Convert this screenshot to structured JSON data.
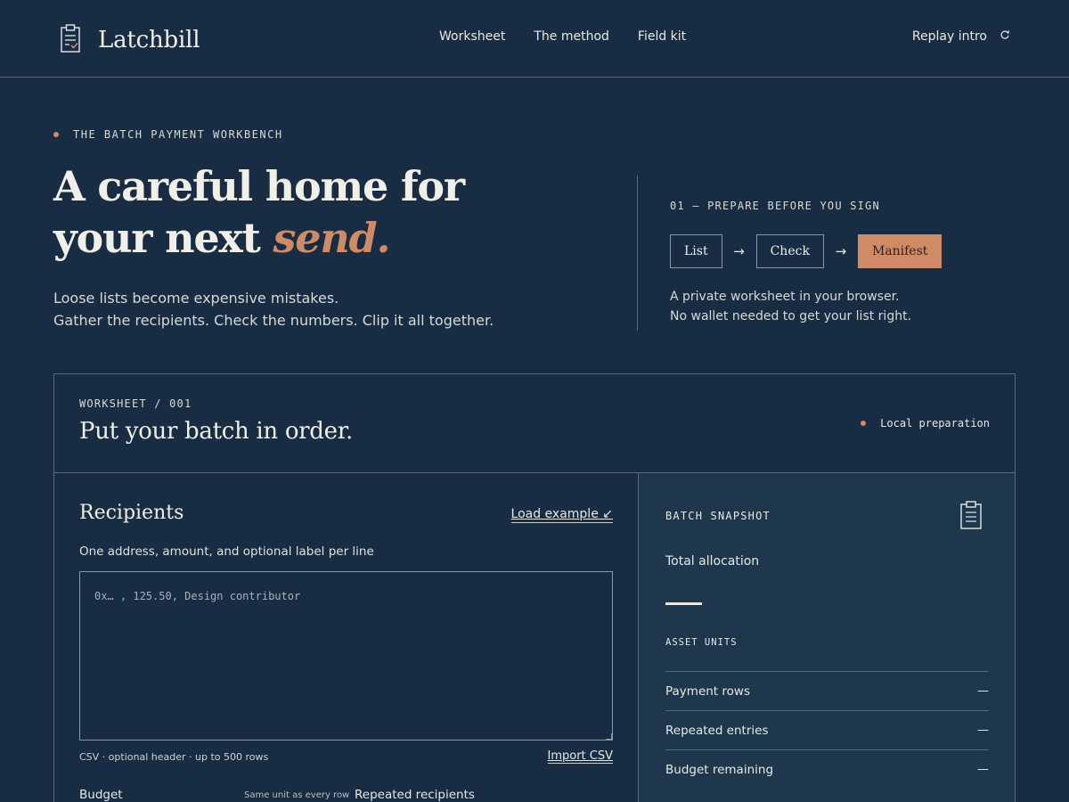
{
  "brand": {
    "name": "Latchbill"
  },
  "nav": {
    "items": [
      "Worksheet",
      "The method",
      "Field kit"
    ],
    "replay_label": "Replay intro"
  },
  "hero": {
    "eyebrow": "THE BATCH PAYMENT WORKBENCH",
    "title_line1": "A careful home for",
    "title_line2_start": "your next",
    "title_accent": "send.",
    "sub_line1": "Loose lists become expensive mistakes.",
    "sub_line2": "Gather the recipients. Check the numbers. Clip it all together."
  },
  "steps": {
    "label": "01 — PREPARE BEFORE YOU SIGN",
    "items": [
      "List",
      "Check",
      "Manifest"
    ],
    "active": "Manifest",
    "note_line1": "A private worksheet in your browser.",
    "note_line2": "No wallet needed to get your list right."
  },
  "worksheet": {
    "label": "WORKSHEET / 001",
    "title": "Put your batch in order.",
    "status": "Local preparation",
    "recipients": {
      "title": "Recipients",
      "load_example": "Load example ↙",
      "help": "One address, amount, and optional label per line",
      "value": "",
      "placeholder": "0x… , 125.50, Design contributor",
      "csv_note": "CSV · optional header · up to 500 rows",
      "import_label": "Import CSV",
      "budget_label": "Budget",
      "same_unit_note": "Same unit as every row",
      "repeated_label": "Repeated recipients"
    },
    "snapshot": {
      "label": "BATCH SNAPSHOT",
      "total_label": "Total allocation",
      "units_label": "ASSET UNITS",
      "metrics": [
        {
          "label": "Payment rows",
          "value": "—"
        },
        {
          "label": "Repeated entries",
          "value": "—"
        },
        {
          "label": "Budget remaining",
          "value": "—"
        }
      ]
    }
  },
  "colors": {
    "background": "#182c43",
    "panel": "#1f374c",
    "accent": "#cf8a66",
    "border": "#5b6a7b"
  },
  "icons": {
    "brand": "clipboard-check-icon",
    "replay": "refresh-icon",
    "snapshot": "clipboard-list-icon"
  }
}
